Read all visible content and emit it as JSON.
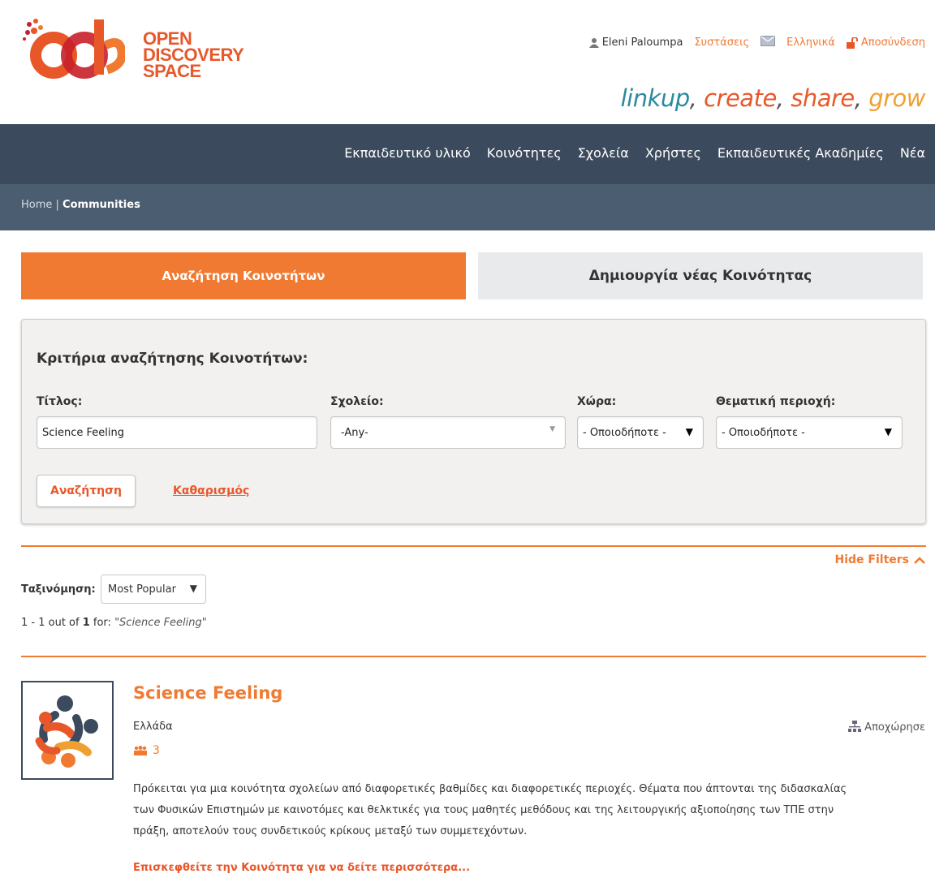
{
  "header": {
    "logo_text": [
      "OPEN",
      "DISCOVERY",
      "SPACE"
    ],
    "user_name": "Eleni Paloumpa",
    "recommendations": "Συστάσεις",
    "language": "Ελληνικά",
    "logout": "Αποσύνδεση",
    "tagline": {
      "w1": "linkup",
      "w2": "create",
      "w3": "share",
      "w4": "grow"
    }
  },
  "nav": {
    "items": [
      "Εκπαιδευτικό υλικό",
      "Κοινότητες",
      "Σχολεία",
      "Χρήστες",
      "Εκπαιδευτικές Ακαδημίες",
      "Νέα"
    ]
  },
  "breadcrumb": {
    "home": "Home",
    "current": "Communities"
  },
  "tabs": {
    "search": "Αναζήτηση Κοινοτήτων",
    "create": "Δημιουργία νέας Κοινότητας"
  },
  "criteria": {
    "title": "Κριτήρια αναζήτησης Κοινοτήτων:",
    "title_label": "Τίτλος:",
    "title_value": "Science Feeling",
    "school_label": "Σχολείο:",
    "school_value": "-Any-",
    "country_label": "Χώρα:",
    "country_value": "- Οποιοδήποτε -",
    "topic_label": "Θεματική περιοχή:",
    "topic_value": "- Οποιοδήποτε -",
    "search_button": "Αναζήτηση",
    "clear_link": "Καθαρισμός"
  },
  "results": {
    "hide_filters": "Hide Filters",
    "sort_label": "Ταξινόμηση:",
    "sort_value": "Most Popular",
    "count_range": "1 - 1 out of ",
    "count_total": "1",
    "count_for": " for: ",
    "count_query": "\"Science Feeling\"",
    "item": {
      "title": "Science Feeling",
      "country": "Ελλάδα",
      "members": "3",
      "leave": "Αποχώρησε",
      "description": "Πρόκειται για μια κοινότητα σχολείων από διαφορετικές βαθμίδες και διαφορετικές περιοχές. Θέματα που άπτονται της διδασκαλίας των Φυσικών Επιστημών με καινοτόμες και θελκτικές για τους μαθητές μεθόδους και της λειτουργικής αξιοποίησης των ΤΠΕ στην πράξη, αποτελούν τους συνδετικούς κρίκους μεταξύ των συμμετεχόντων.",
      "more": "Επισκεφθείτε την Κοινότητα για να δείτε περισσότερα..."
    }
  },
  "colors": {
    "accent": "#f07a32",
    "nav": "#3b4b5d",
    "breadcrumb": "#4b5d70"
  }
}
